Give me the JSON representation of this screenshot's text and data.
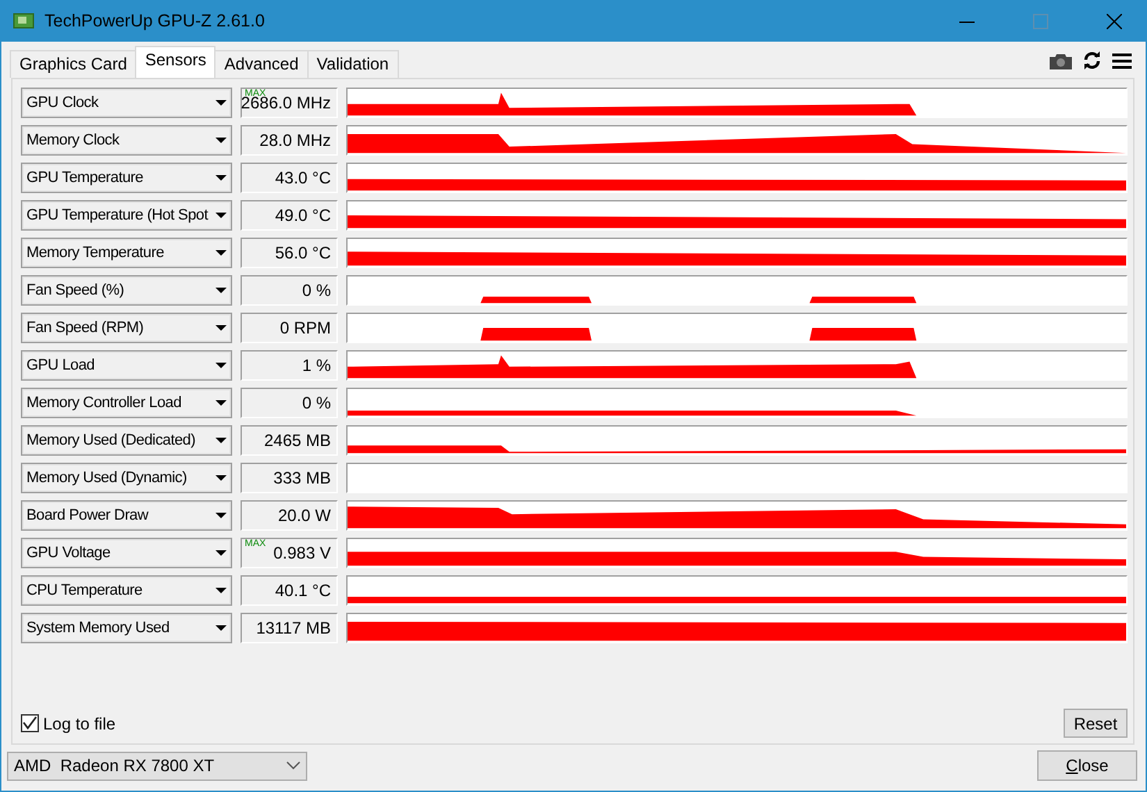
{
  "window": {
    "title": "TechPowerUp GPU-Z 2.61.0"
  },
  "tabs": [
    {
      "label": "Graphics Card",
      "selected": false
    },
    {
      "label": "Sensors",
      "selected": true
    },
    {
      "label": "Advanced",
      "selected": false
    },
    {
      "label": "Validation",
      "selected": false
    }
  ],
  "sensors": [
    {
      "name": "GPU Clock",
      "value": "2686.0 MHz",
      "badge": "MAX"
    },
    {
      "name": "Memory Clock",
      "value": "28.0 MHz"
    },
    {
      "name": "GPU Temperature",
      "value": "43.0 °C"
    },
    {
      "name": "GPU Temperature (Hot Spot",
      "value": "49.0 °C"
    },
    {
      "name": "Memory Temperature",
      "value": "56.0 °C"
    },
    {
      "name": "Fan Speed (%)",
      "value": "0 %"
    },
    {
      "name": "Fan Speed (RPM)",
      "value": "0 RPM"
    },
    {
      "name": "GPU Load",
      "value": "1 %"
    },
    {
      "name": "Memory Controller Load",
      "value": "0 %"
    },
    {
      "name": "Memory Used (Dedicated)",
      "value": "2465 MB"
    },
    {
      "name": "Memory Used (Dynamic)",
      "value": "333 MB"
    },
    {
      "name": "Board Power Draw",
      "value": "20.0 W"
    },
    {
      "name": "GPU Voltage",
      "value": "0.983 V",
      "badge": "MAX"
    },
    {
      "name": "CPU Temperature",
      "value": "40.1 °C"
    },
    {
      "name": "System Memory Used",
      "value": "13117 MB"
    }
  ],
  "log_to_file": {
    "label": "Log to file",
    "checked": true
  },
  "reset_button": "Reset",
  "gpu_select": "AMD  Radeon RX 7800 XT",
  "close_button": "Close"
}
